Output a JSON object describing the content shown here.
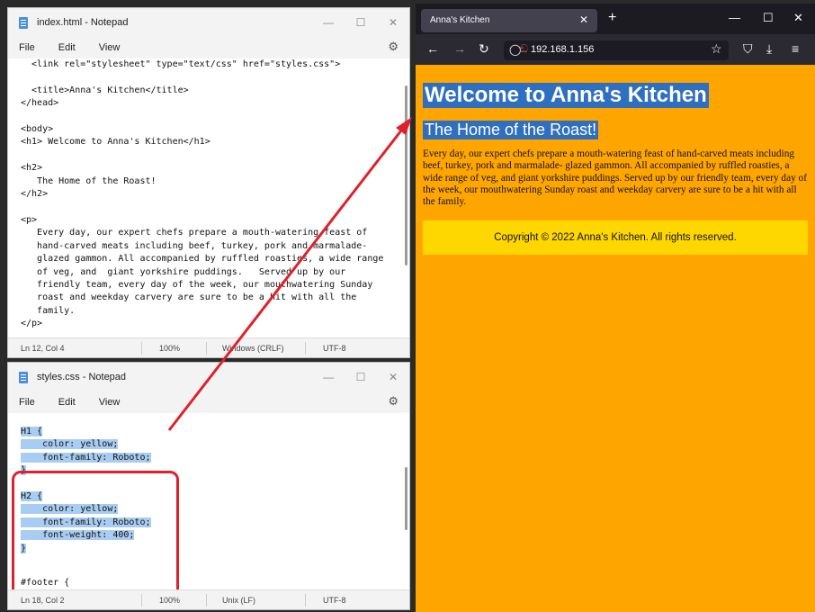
{
  "notepad1": {
    "title": "index.html - Notepad",
    "menu": [
      "File",
      "Edit",
      "View"
    ],
    "code": "  <link rel=\"stylesheet\" type=\"text/css\" href=\"styles.css\">\n\n  <title>Anna's Kitchen</title>\n</head>\n\n<body>\n<h1> Welcome to Anna's Kitchen</h1>\n\n<h2>\n   The Home of the Roast!\n</h2>\n\n<p>\n   Every day, our expert chefs prepare a mouth-watering feast of\n   hand-carved meats including beef, turkey, pork and marmalade-\n   glazed gammon. All accompanied by ruffled roasties, a wide range\n   of veg, and  giant yorkshire puddings.   Served up by our\n   friendly team, every day of the week, our mouthwatering Sunday\n   roast and weekday carvery are sure to be a hit with all the\n   family.\n</p>",
    "status": {
      "position": "Ln 12, Col 4",
      "zoom": "100%",
      "eol": "Windows (CRLF)",
      "encoding": "UTF-8"
    }
  },
  "notepad2": {
    "title": "styles.css - Notepad",
    "menu": [
      "File",
      "Edit",
      "View"
    ],
    "code_selected": "H1 {\n    color: yellow;\n    font-family: Roboto;\n}\n\nH2 {\n    color: yellow;\n    font-family: Roboto;\n    font-weight: 400;\n}",
    "code_rest": "#footer {",
    "status": {
      "position": "Ln 18, Col 2",
      "zoom": "100%",
      "eol": "Unix (LF)",
      "encoding": "UTF-8"
    }
  },
  "browser": {
    "tab_title": "Anna's Kitchen",
    "url": "192.168.1.156",
    "h1": "Welcome to Anna's Kitchen",
    "h2": "The Home of the Roast!",
    "paragraph": "Every day, our expert chefs prepare a mouth-watering feast of hand-carved meats including beef, turkey, pork and marmalade- glazed gammon. All accompanied by ruffled roasties, a wide range of veg, and giant yorkshire puddings. Served up by our friendly team, every day of the week, our mouthwatering Sunday roast and weekday carvery are sure to be a hit with all the family.",
    "footer": "Copyright © 2022 Anna's Kitchen. All rights reserved."
  },
  "colors": {
    "page_bg": "#ffa500",
    "footer_bg": "#ffd700",
    "highlight": "#2f6fbf",
    "annotation": "#e0202b",
    "selection": "#a9cdf2"
  },
  "icons": [
    "notepad-icon",
    "gear-icon",
    "back-icon",
    "forward-icon",
    "reload-icon",
    "shield-icon",
    "lock-icon",
    "star-icon",
    "pocket-icon",
    "download-icon",
    "menu-icon"
  ]
}
